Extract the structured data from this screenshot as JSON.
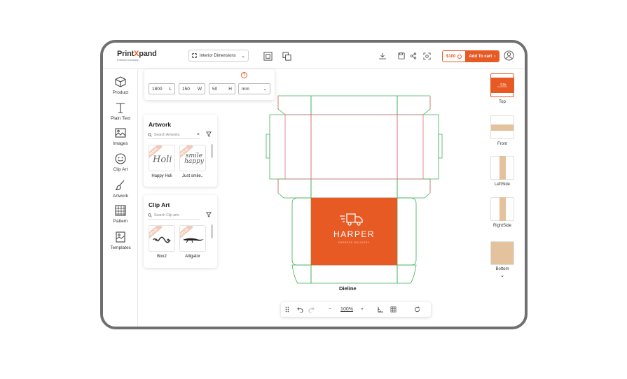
{
  "header": {
    "logo_main_a": "Print",
    "logo_main_x": "X",
    "logo_main_b": "pand",
    "logo_sub": "A WebArt Company",
    "dim_select": "Interior Dimensions",
    "price": "$100",
    "add_to_cart": "Add To cart"
  },
  "sidebar": {
    "items": [
      {
        "label": "Product",
        "icon": "cube-icon"
      },
      {
        "label": "Plain Text",
        "icon": "text-icon"
      },
      {
        "label": "Images",
        "icon": "image-icon"
      },
      {
        "label": "Clip Art",
        "icon": "smiley-icon"
      },
      {
        "label": "Artwork",
        "icon": "brush-icon"
      },
      {
        "label": "Pattern",
        "icon": "pattern-icon"
      },
      {
        "label": "Templates",
        "icon": "templates-icon"
      }
    ]
  },
  "dimensions": {
    "length": "1800",
    "length_unit": "L",
    "width": "150",
    "width_unit": "W",
    "height": "50",
    "height_unit": "H",
    "unit": "mm"
  },
  "artwork_panel": {
    "title": "Artwork",
    "search_placeholder": "Search Artworks",
    "items": [
      {
        "label": "Happy Holi",
        "ribbon": "$25.00",
        "art": "Holi"
      },
      {
        "label": "Just smile..",
        "ribbon": "$25.00",
        "art": "smile happy"
      }
    ]
  },
  "clipart_panel": {
    "title": "Clip Art",
    "search_placeholder": "Search Clip arts",
    "items": [
      {
        "label": "Box2",
        "ribbon": "$25.00"
      },
      {
        "label": "Alligator",
        "ribbon": "$25.00"
      }
    ]
  },
  "canvas": {
    "label": "Dieline",
    "brand": "HARPER",
    "brand_sub": "EXPRESS DELIVERY",
    "accent": "#e85a24"
  },
  "toolbar": {
    "zoom": "100%"
  },
  "faces": [
    {
      "label": "Top"
    },
    {
      "label": "Front"
    },
    {
      "label": "LeftSide"
    },
    {
      "label": "RightSide"
    },
    {
      "label": "Bottom"
    }
  ]
}
